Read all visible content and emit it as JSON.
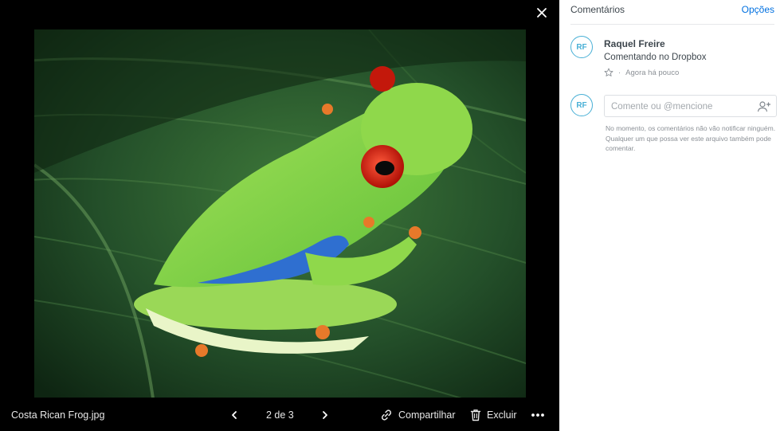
{
  "viewer": {
    "filename": "Costa Rican Frog.jpg",
    "pager": "2 de 3",
    "share_label": "Compartilhar",
    "delete_label": "Excluir",
    "icons": {
      "close": "close-icon",
      "prev": "chevron-left-icon",
      "next": "chevron-right-icon",
      "share": "link-icon",
      "delete": "trash-icon",
      "more": "more-horizontal-icon"
    }
  },
  "comments": {
    "title": "Comentários",
    "options_label": "Opções",
    "items": [
      {
        "initials": "RF",
        "author": "Raquel Freire",
        "text": "Comentando no Dropbox",
        "time": "Agora há pouco"
      }
    ],
    "composer": {
      "initials": "RF",
      "placeholder": "Comente ou @mencione",
      "value": ""
    },
    "notice": "No momento, os comentários não vão notificar ninguém. Qualquer um que possa ver este arquivo também pode comentar."
  },
  "colors": {
    "accent": "#0070e0",
    "avatar": "#49b0d6",
    "viewer_bg": "#000000"
  }
}
